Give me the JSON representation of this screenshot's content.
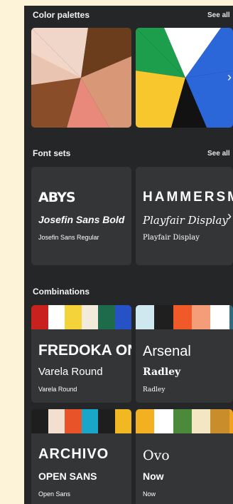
{
  "sections": {
    "palettes": {
      "title": "Color palettes",
      "see_all": "See all"
    },
    "fonts": {
      "title": "Font sets",
      "see_all": "See all"
    },
    "combinations": {
      "title": "Combinations"
    }
  },
  "font_sets": [
    {
      "display": "ABYS",
      "heading": "Josefin Sans Bold",
      "body": "Josefin Sans Regular"
    },
    {
      "display": "HAMMERSMITH",
      "heading": "Playfair Display",
      "body": "Playfair Display"
    }
  ],
  "combinations": [
    {
      "display": "FREDOKA ONE",
      "heading": "Varela Round",
      "body": "Varela Round",
      "colors": [
        "#c8211e",
        "#ffffff",
        "#f3d23a",
        "#f2eadb",
        "#1e6b4c",
        "#2752c5"
      ]
    },
    {
      "display": "Arsenal",
      "heading": "Radley",
      "body": "Radley",
      "colors": [
        "#cfe8ef",
        "#1f1f1f",
        "#f05a28",
        "#f49d78",
        "#ffffff",
        "#2f6b7f"
      ]
    },
    {
      "display": "ARCHIVO",
      "heading": "OPEN SANS",
      "body": "Open Sans",
      "colors": [
        "#1e1e1e",
        "#f2dfcf",
        "#e8532a",
        "#1aa6c9",
        "#1e1e1e",
        "#f1b821"
      ]
    },
    {
      "display": "Ovo",
      "heading": "Now",
      "body": "Now",
      "colors": [
        "#f3b021",
        "#ffffff",
        "#4c8a3b",
        "#f5e6c3",
        "#c98d2b",
        "#f0a31e"
      ]
    }
  ],
  "palette_colors": {
    "p1": [
      "#f0d6c9",
      "#6b3d1c",
      "#b57a4f",
      "#e8897c",
      "#efa98c",
      "#8a4d2a"
    ],
    "p2": [
      "#ffffff",
      "#1d9e4d",
      "#2b67d8",
      "#f8c62d",
      "#121212",
      "#e8342e"
    ]
  },
  "icons": {
    "next": "chevron-right-icon"
  }
}
